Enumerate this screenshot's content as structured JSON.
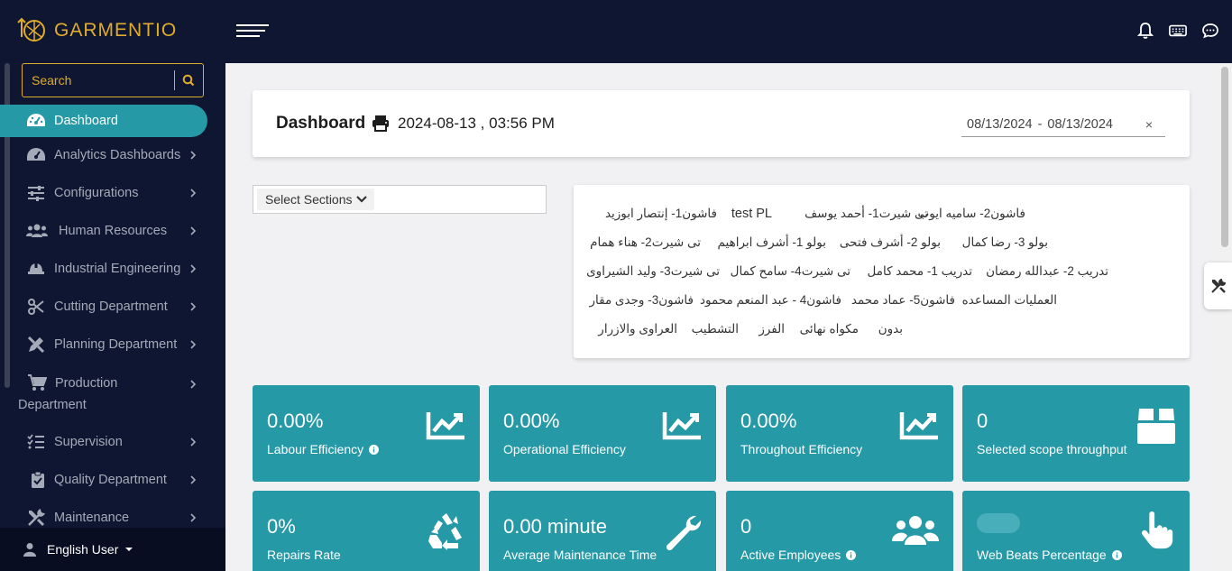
{
  "app": {
    "brand": "GARMENTIO",
    "colors": {
      "accent": "#e0ac2c",
      "teal": "#2699a6",
      "navy": "#0f1631"
    }
  },
  "topbar": {
    "icons": [
      "bell-icon",
      "keyboard-icon",
      "chat-icon"
    ]
  },
  "sidebar": {
    "search_placeholder": "Search",
    "items": [
      {
        "label": "Dashboard",
        "icon": "dashboard-gauge-icon",
        "active": true
      },
      {
        "label": "Analytics Dashboards",
        "icon": "gauge-icon"
      },
      {
        "label": "Configurations",
        "icon": "sliders-icon"
      },
      {
        "label": "Human Resources",
        "icon": "users-icon"
      },
      {
        "label": "Industrial Engineering",
        "icon": "hardhat-icon"
      },
      {
        "label": "Cutting Department",
        "icon": "scissors-icon"
      },
      {
        "label": "Planning Department",
        "icon": "pencil-ruler-icon"
      },
      {
        "label_line1": "Production",
        "label_line2": "Department",
        "icon": "cart-icon"
      },
      {
        "label": "Supervision",
        "icon": "checklist-icon"
      },
      {
        "label": "Quality Department",
        "icon": "clipboard-check-icon"
      },
      {
        "label": "Maintenance",
        "icon": "tools-icon"
      }
    ],
    "user": {
      "label": "English User"
    }
  },
  "header": {
    "title": "Dashboard",
    "datetime": "2024-08-13 , 03:56 PM",
    "date_from": "08/13/2024",
    "date_sep": "-",
    "date_to": "08/13/2024",
    "clear": "×"
  },
  "sections": {
    "select_label": "Select Sections",
    "rows": [
      [
        "فاشون2- ساميه ايوب",
        "تى شيرت1- أحمد يوسف",
        "test PL",
        "فاشون1- إنتصار ابوزيد"
      ],
      [
        "بولو 3- رضا كمال",
        "بولو 2- أشرف فتحى",
        "بولو 1- أشرف ابراهيم",
        "تى شيرت2- هناء همام"
      ],
      [
        "تدريب 2- عبدالله رمضان",
        "تدريب 1- محمد كامل",
        "تى شيرت4- سامح كمال",
        "تى شيرت3- وليد الشيراوى"
      ],
      [
        "العمليات المساعده",
        "فاشون5- عماد محمد",
        "فاشون4 - عبد المنعم محمود",
        "فاشون3- وجدى مقار"
      ],
      [
        "بدون",
        "مكواه نهائى",
        "الفرز",
        "التشطيب",
        "العراوى والازرار"
      ]
    ]
  },
  "tiles": [
    {
      "value": "0.00%",
      "label": "Labour Efficiency",
      "info": true,
      "icon": "trend-chart-icon"
    },
    {
      "value": "0.00%",
      "label": "Operational Efficiency",
      "info": false,
      "icon": "trend-chart-icon"
    },
    {
      "value": "0.00%",
      "label": "Throughout Efficiency",
      "info": false,
      "icon": "trend-chart-icon"
    },
    {
      "value": "0",
      "label": "Selected scope throughput",
      "info": false,
      "icon": "box-icon"
    },
    {
      "value": "0%",
      "label": "Repairs Rate",
      "info": false,
      "icon": "recycle-icon"
    },
    {
      "value": "0.00 minute",
      "label": "Average Maintenance Time",
      "info": false,
      "icon": "wrench-icon"
    },
    {
      "value": "0",
      "label": "Active Employees",
      "info": true,
      "icon": "users-group-icon"
    },
    {
      "value": "",
      "label": "Web Beats Percentage",
      "info": true,
      "icon": "hand-pointer-icon"
    }
  ]
}
